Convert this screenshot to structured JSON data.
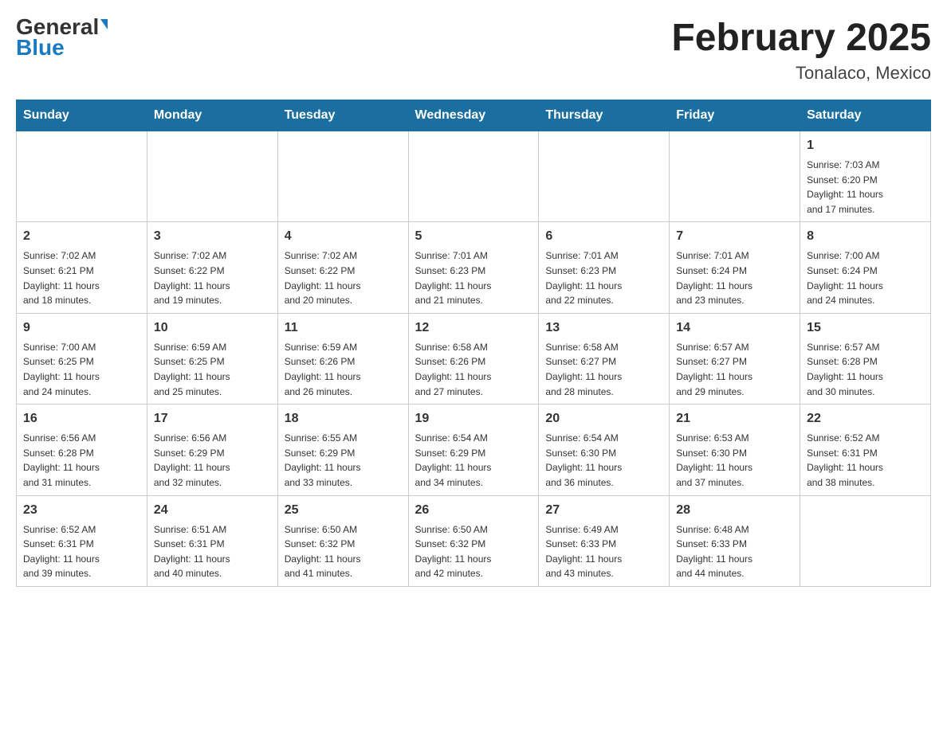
{
  "header": {
    "logo_general": "General",
    "logo_blue": "Blue",
    "month_title": "February 2025",
    "location": "Tonalaco, Mexico"
  },
  "days_of_week": [
    "Sunday",
    "Monday",
    "Tuesday",
    "Wednesday",
    "Thursday",
    "Friday",
    "Saturday"
  ],
  "weeks": [
    {
      "cells": [
        {
          "day": "",
          "info": ""
        },
        {
          "day": "",
          "info": ""
        },
        {
          "day": "",
          "info": ""
        },
        {
          "day": "",
          "info": ""
        },
        {
          "day": "",
          "info": ""
        },
        {
          "day": "",
          "info": ""
        },
        {
          "day": "1",
          "info": "Sunrise: 7:03 AM\nSunset: 6:20 PM\nDaylight: 11 hours\nand 17 minutes."
        }
      ]
    },
    {
      "cells": [
        {
          "day": "2",
          "info": "Sunrise: 7:02 AM\nSunset: 6:21 PM\nDaylight: 11 hours\nand 18 minutes."
        },
        {
          "day": "3",
          "info": "Sunrise: 7:02 AM\nSunset: 6:22 PM\nDaylight: 11 hours\nand 19 minutes."
        },
        {
          "day": "4",
          "info": "Sunrise: 7:02 AM\nSunset: 6:22 PM\nDaylight: 11 hours\nand 20 minutes."
        },
        {
          "day": "5",
          "info": "Sunrise: 7:01 AM\nSunset: 6:23 PM\nDaylight: 11 hours\nand 21 minutes."
        },
        {
          "day": "6",
          "info": "Sunrise: 7:01 AM\nSunset: 6:23 PM\nDaylight: 11 hours\nand 22 minutes."
        },
        {
          "day": "7",
          "info": "Sunrise: 7:01 AM\nSunset: 6:24 PM\nDaylight: 11 hours\nand 23 minutes."
        },
        {
          "day": "8",
          "info": "Sunrise: 7:00 AM\nSunset: 6:24 PM\nDaylight: 11 hours\nand 24 minutes."
        }
      ]
    },
    {
      "cells": [
        {
          "day": "9",
          "info": "Sunrise: 7:00 AM\nSunset: 6:25 PM\nDaylight: 11 hours\nand 24 minutes."
        },
        {
          "day": "10",
          "info": "Sunrise: 6:59 AM\nSunset: 6:25 PM\nDaylight: 11 hours\nand 25 minutes."
        },
        {
          "day": "11",
          "info": "Sunrise: 6:59 AM\nSunset: 6:26 PM\nDaylight: 11 hours\nand 26 minutes."
        },
        {
          "day": "12",
          "info": "Sunrise: 6:58 AM\nSunset: 6:26 PM\nDaylight: 11 hours\nand 27 minutes."
        },
        {
          "day": "13",
          "info": "Sunrise: 6:58 AM\nSunset: 6:27 PM\nDaylight: 11 hours\nand 28 minutes."
        },
        {
          "day": "14",
          "info": "Sunrise: 6:57 AM\nSunset: 6:27 PM\nDaylight: 11 hours\nand 29 minutes."
        },
        {
          "day": "15",
          "info": "Sunrise: 6:57 AM\nSunset: 6:28 PM\nDaylight: 11 hours\nand 30 minutes."
        }
      ]
    },
    {
      "cells": [
        {
          "day": "16",
          "info": "Sunrise: 6:56 AM\nSunset: 6:28 PM\nDaylight: 11 hours\nand 31 minutes."
        },
        {
          "day": "17",
          "info": "Sunrise: 6:56 AM\nSunset: 6:29 PM\nDaylight: 11 hours\nand 32 minutes."
        },
        {
          "day": "18",
          "info": "Sunrise: 6:55 AM\nSunset: 6:29 PM\nDaylight: 11 hours\nand 33 minutes."
        },
        {
          "day": "19",
          "info": "Sunrise: 6:54 AM\nSunset: 6:29 PM\nDaylight: 11 hours\nand 34 minutes."
        },
        {
          "day": "20",
          "info": "Sunrise: 6:54 AM\nSunset: 6:30 PM\nDaylight: 11 hours\nand 36 minutes."
        },
        {
          "day": "21",
          "info": "Sunrise: 6:53 AM\nSunset: 6:30 PM\nDaylight: 11 hours\nand 37 minutes."
        },
        {
          "day": "22",
          "info": "Sunrise: 6:52 AM\nSunset: 6:31 PM\nDaylight: 11 hours\nand 38 minutes."
        }
      ]
    },
    {
      "cells": [
        {
          "day": "23",
          "info": "Sunrise: 6:52 AM\nSunset: 6:31 PM\nDaylight: 11 hours\nand 39 minutes."
        },
        {
          "day": "24",
          "info": "Sunrise: 6:51 AM\nSunset: 6:31 PM\nDaylight: 11 hours\nand 40 minutes."
        },
        {
          "day": "25",
          "info": "Sunrise: 6:50 AM\nSunset: 6:32 PM\nDaylight: 11 hours\nand 41 minutes."
        },
        {
          "day": "26",
          "info": "Sunrise: 6:50 AM\nSunset: 6:32 PM\nDaylight: 11 hours\nand 42 minutes."
        },
        {
          "day": "27",
          "info": "Sunrise: 6:49 AM\nSunset: 6:33 PM\nDaylight: 11 hours\nand 43 minutes."
        },
        {
          "day": "28",
          "info": "Sunrise: 6:48 AM\nSunset: 6:33 PM\nDaylight: 11 hours\nand 44 minutes."
        },
        {
          "day": "",
          "info": ""
        }
      ]
    }
  ]
}
